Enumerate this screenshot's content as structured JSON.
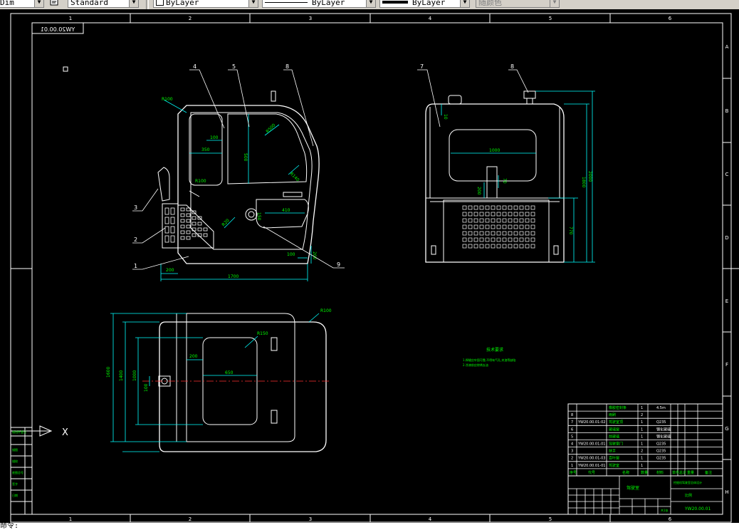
{
  "toolbar": {
    "dim_style": "Dim",
    "text_style": "Standard",
    "layer": "ByLayer",
    "linetype": "ByLayer",
    "lineweight": "ByLayer",
    "plot_color": "随颜色"
  },
  "drawing": {
    "top_labels": [
      "1",
      "2",
      "3",
      "4",
      "5",
      "6"
    ],
    "bottom_labels": [
      "1",
      "2",
      "3",
      "4",
      "5",
      "6"
    ],
    "right_labels": [
      "A",
      "B",
      "C",
      "D",
      "E",
      "F",
      "G",
      "H"
    ],
    "sheet_id_flipped": "YW20.00.01",
    "views": {
      "front": {
        "balloons": [
          "4",
          "5",
          "8",
          "3",
          "2",
          "1",
          "9"
        ],
        "dims": {
          "r100_top": "R100",
          "d100": "100",
          "d350": "350",
          "d500": "500",
          "r500": "R500",
          "r100_win": "R100",
          "r140": "R140",
          "d410": "410",
          "d150": "150",
          "r20": "R20",
          "d100b": "100",
          "d200": "200",
          "d200b": "200",
          "d1700": "1700"
        }
      },
      "side": {
        "balloons": [
          "7",
          "8"
        ],
        "dims": {
          "d10": "10",
          "d1000": "1000",
          "d200": "200",
          "d70": "70",
          "d1800": "1800",
          "d2000": "2000",
          "d770": "770"
        }
      },
      "top": {
        "dims": {
          "r100": "R100",
          "r150": "R150",
          "d200": "200",
          "d650": "650",
          "d1600": "1600",
          "d1400": "1400",
          "d1000": "1000",
          "d100": "100"
        }
      }
    },
    "notes": {
      "title": "技术要求",
      "lines": [
        "1.焊缝应牢固可靠,不得有气孔,夹渣等缺陷",
        "2.涂漆前应除锈去油"
      ]
    },
    "ucs_label": "X",
    "bom_rows": [
      {
        "no": "",
        "code": "",
        "name": "橡胶密封条",
        "qty": "1",
        "mat": "4.5m"
      },
      {
        "no": "8",
        "code": "",
        "name": "雨刷",
        "qty": "2",
        "mat": ""
      },
      {
        "no": "7",
        "code": "YW20.00.01-02",
        "name": "驾驶室顶",
        "qty": "1",
        "mat": "Q235"
      },
      {
        "no": "6",
        "code": "",
        "name": "玻璃窗",
        "qty": "1",
        "mat": "钢化玻璃"
      },
      {
        "no": "5",
        "code": "",
        "name": "前玻璃",
        "qty": "1",
        "mat": "钢化玻璃"
      },
      {
        "no": "4",
        "code": "YW20.00.01-01",
        "name": "驾驶室门",
        "qty": "1",
        "mat": "Q235"
      },
      {
        "no": "3",
        "code": "",
        "name": "扶手",
        "qty": "2",
        "mat": "Q235"
      },
      {
        "no": "2",
        "code": "YW20.00.01-03",
        "name": "百叶窗",
        "qty": "1",
        "mat": "Q235"
      },
      {
        "no": "1",
        "code": "YW20.00.01-01",
        "name": "驾驶室",
        "qty": "1",
        "mat": ""
      }
    ],
    "bom_header": [
      "序号",
      "代号",
      "名称",
      "数量",
      "材料",
      "单件",
      "总计",
      "重量",
      "备注"
    ],
    "title_block": {
      "company": "挖掘机驾驶室总体设计",
      "part": "驾驶室",
      "scale": "比例",
      "drawing_no": "YW20.00.01",
      "sheet": "共1张"
    },
    "left_strip": [
      "借用件登记",
      "描图",
      "描校",
      "底图总号",
      "签字",
      "日期"
    ]
  },
  "cmdline": "命令:"
}
